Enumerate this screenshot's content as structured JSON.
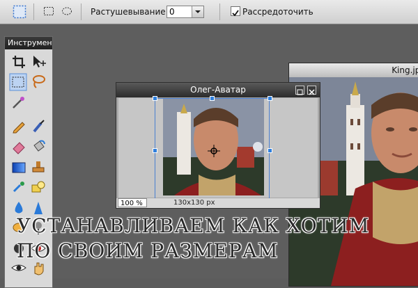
{
  "toolbar": {
    "feather_label": "Растушевывание:",
    "feather_value": "0",
    "antialias_label": "Рассредоточить",
    "antialias_checked": true
  },
  "tool_panel": {
    "title": "Инструменты"
  },
  "big_window": {
    "title": "King.jpg"
  },
  "avatar_window": {
    "title": "Олег-Аватар",
    "zoom": "100 %",
    "size": "130x130 px"
  },
  "caption": {
    "line1": "УСТАНАВЛИВАЕМ КАК ХОТИМ",
    "line2": "ПО СВОИМ РАЗМЕРАМ"
  }
}
